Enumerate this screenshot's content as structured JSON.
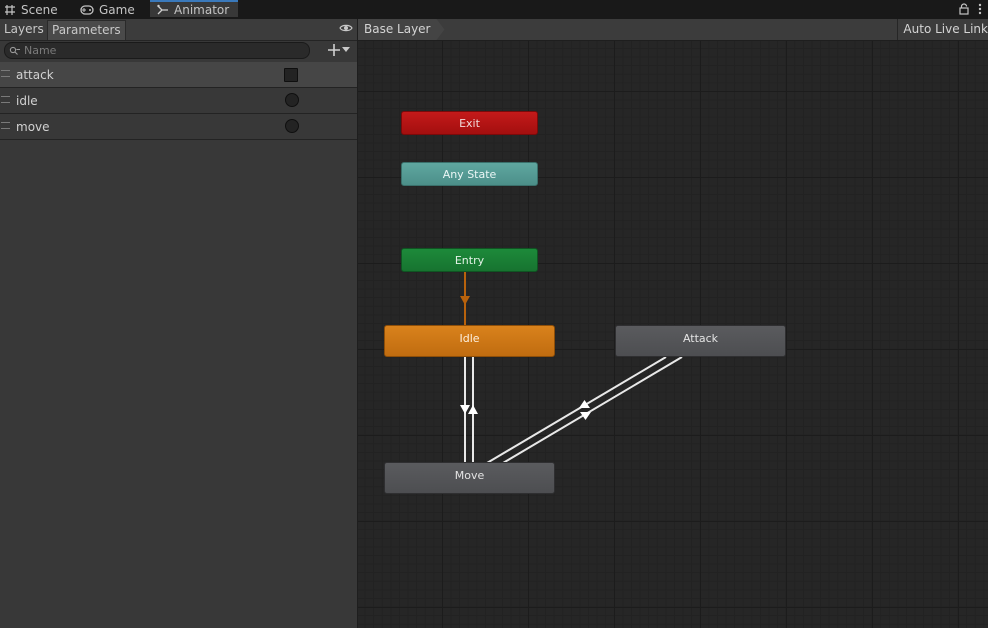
{
  "tabs": [
    {
      "label": "Scene",
      "icon": "grid-icon"
    },
    {
      "label": "Game",
      "icon": "gamepad-icon"
    },
    {
      "label": "Animator",
      "icon": "animator-icon"
    }
  ],
  "left_panel": {
    "subtabs": [
      "Layers",
      "Parameters"
    ],
    "search_placeholder": "Name",
    "parameters": [
      {
        "name": "attack",
        "type": "trigger"
      },
      {
        "name": "idle",
        "type": "bool"
      },
      {
        "name": "move",
        "type": "bool"
      }
    ]
  },
  "graph": {
    "breadcrumb": "Base Layer",
    "auto_live_link": "Auto Live Link",
    "nodes": {
      "exit": "Exit",
      "any_state": "Any State",
      "entry": "Entry",
      "idle": "Idle",
      "attack": "Attack",
      "move": "Move"
    }
  },
  "colors": {
    "exit": "#b31515",
    "any_state": "#559c95",
    "entry": "#1a7f35",
    "default_state": "#cc7716",
    "state": "#535457",
    "accent": "#3a79bb"
  }
}
